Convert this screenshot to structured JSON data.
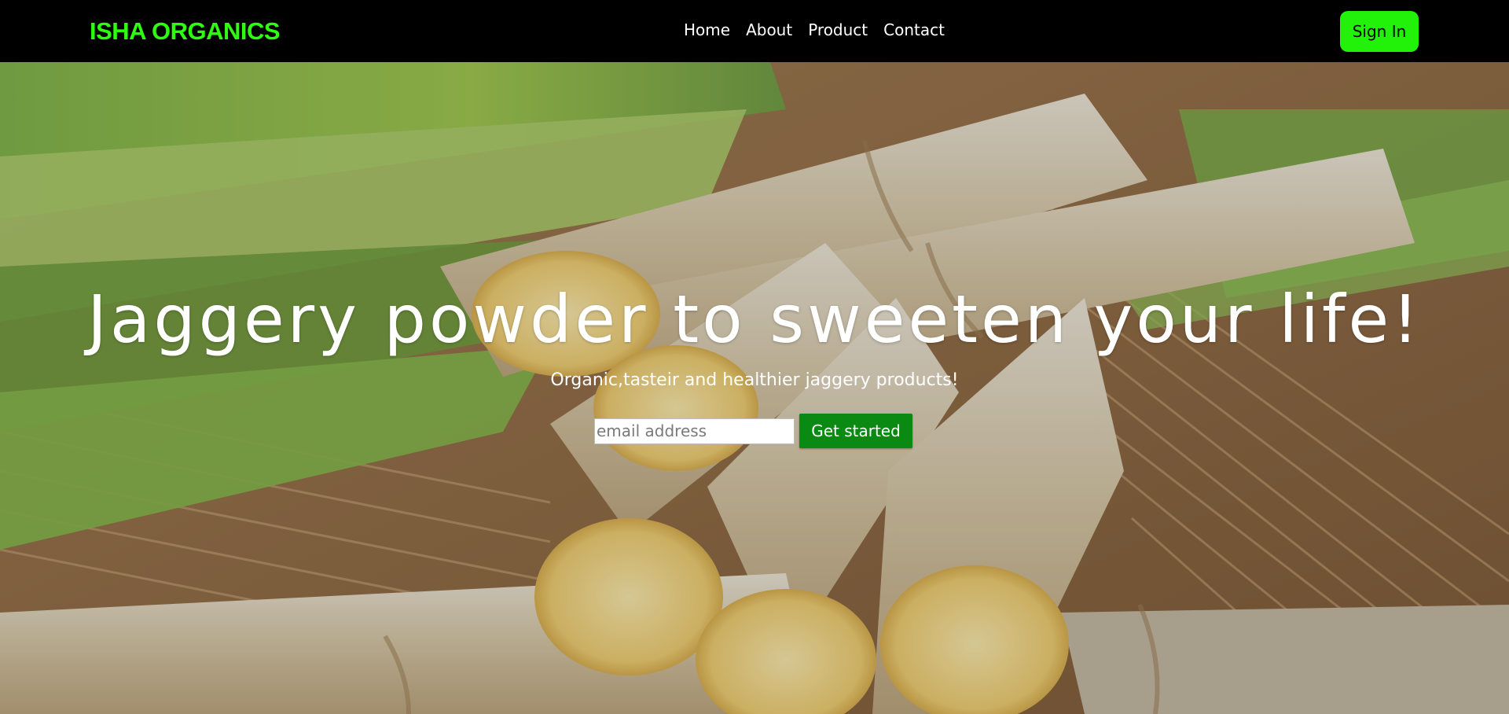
{
  "navbar": {
    "brand": "ISHA ORGANICS",
    "links": [
      "Home",
      "About",
      "Product",
      "Contact"
    ],
    "signin_label": "Sign In"
  },
  "hero": {
    "title": "Jaggery powder to sweeten your life!",
    "subtitle": "Organic,tasteir and healthier jaggery products!",
    "email_placeholder": "email address",
    "cta_label": "Get started",
    "image_subject": "sugarcane-stalks-on-woven-straw"
  },
  "colors": {
    "brand_green": "#2dff0f",
    "signin_green": "#22f20a",
    "cta_green": "#0a8a12",
    "navbar_bg": "#000000"
  }
}
